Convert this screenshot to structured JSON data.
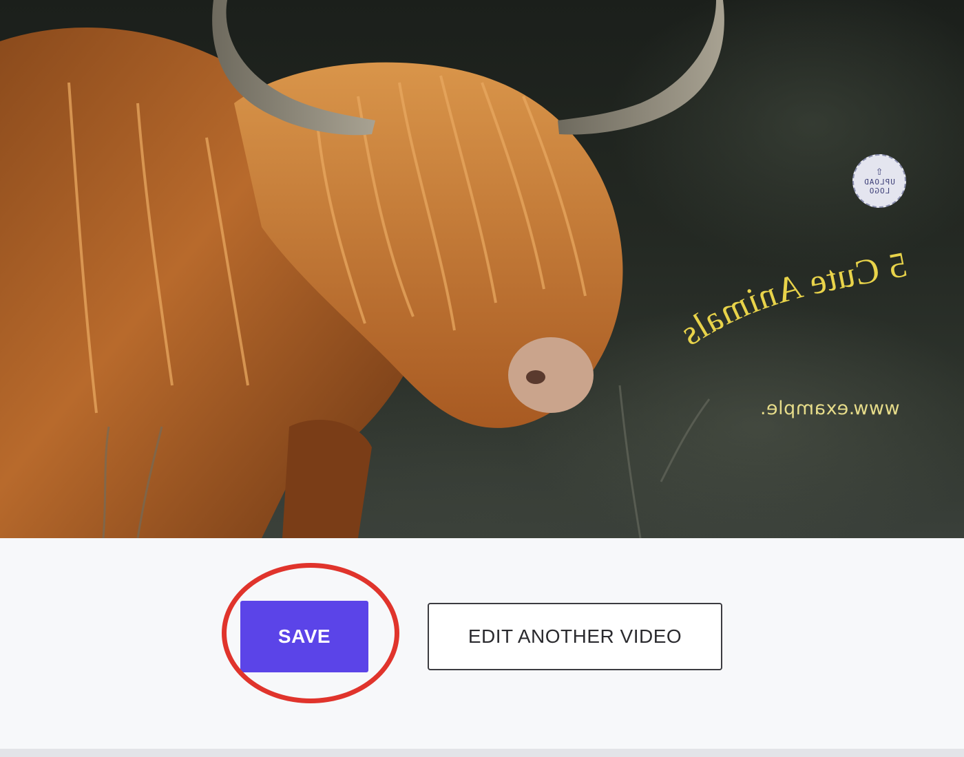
{
  "preview": {
    "image_subject": "highland-cow-photo",
    "logo_badge": {
      "icon": "upload-icon",
      "text": "UPLOAD LOGO"
    },
    "title_text": "5 Cute Animals",
    "title_color": "#e8d34a",
    "url_text": "www.example.",
    "url_color": "#e6dc8a"
  },
  "actions": {
    "save_label": "SAVE",
    "save_color": "#5b44e8",
    "edit_label": "EDIT ANOTHER VIDEO",
    "highlight_color": "#e0342c"
  }
}
